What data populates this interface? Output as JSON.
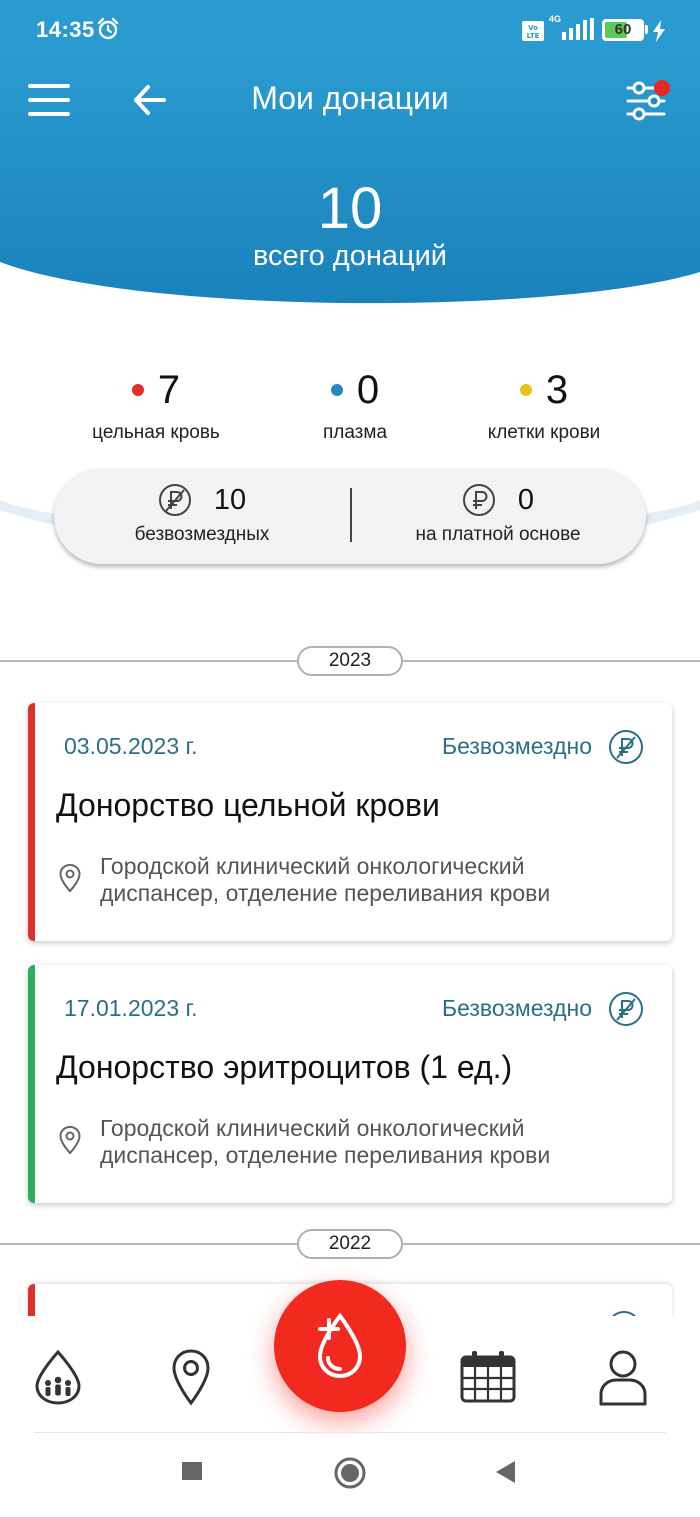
{
  "status_bar": {
    "time": "14:35",
    "network": "4G",
    "battery": "60",
    "battery_level": 0.6,
    "icons": [
      "alarm-icon",
      "volte-icon",
      "signal-icon",
      "battery-icon",
      "charging-icon"
    ]
  },
  "header": {
    "title": "Мои донации",
    "total_count": "10",
    "total_label": "всего донаций",
    "icons": [
      "menu-icon",
      "back-arrow-icon",
      "filter-sliders-icon"
    ],
    "filter_badge_color": "#e62a22",
    "background_color": "#1f8cc3"
  },
  "donation_types": [
    {
      "count": "7",
      "label": "цельная кровь",
      "color": "#e02f2a"
    },
    {
      "count": "0",
      "label": "плазма",
      "color": "#2a86c0"
    },
    {
      "count": "3",
      "label": "клетки крови",
      "color": "#e8c21a"
    }
  ],
  "payment_summary": {
    "free": {
      "count": "10",
      "label": "безвозмездных",
      "icon": "ruble-crossed-icon"
    },
    "paid": {
      "count": "0",
      "label": "на платной основе",
      "icon": "ruble-icon"
    }
  },
  "years": [
    "2023",
    "2022"
  ],
  "donations": [
    {
      "date": "03.05.2023 г.",
      "payment": "Безвозмездно",
      "title": "Донорство цельной крови",
      "place_line1": "Городской клинический онкологический",
      "place_line2": "диспансер, отделение переливания крови",
      "accent_color": "#e02f2a"
    },
    {
      "date": "17.01.2023 г.",
      "payment": "Безвозмездно",
      "title": "Донорство эритроцитов (1 ед.)",
      "place_line1": "Городской клинический онкологический",
      "place_line2": "диспансер, отделение переливания крови",
      "accent_color": "#2fae5a"
    }
  ],
  "bottom_nav": {
    "items": [
      "community-drop-icon",
      "location-pin-icon",
      "add-donation-drop-icon",
      "calendar-icon",
      "profile-icon"
    ],
    "fab_color": "#f2291f"
  },
  "system_nav": [
    "recents-square-icon",
    "home-circle-icon",
    "back-triangle-icon"
  ]
}
